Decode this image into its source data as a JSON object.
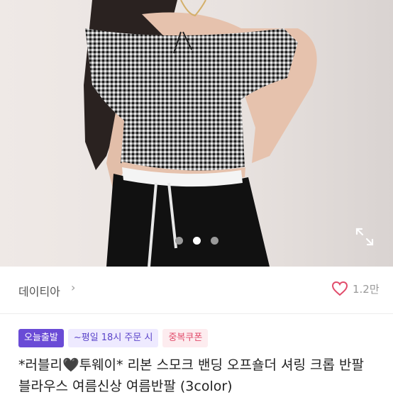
{
  "product": {
    "image_dots": {
      "count": 3,
      "active_index": 1
    },
    "expand_icon": "expand-icon",
    "shop": {
      "name": "데이티아",
      "chevron": "›"
    },
    "like": {
      "count": "1.2만",
      "icon": "heart-outline-icon"
    },
    "badges": {
      "today": "오늘출발",
      "time": "~평일 18시 주문 시",
      "coupon": "중복쿠폰"
    },
    "title": "*러블리🖤투웨이* 리본 스모크 밴딩 오프숄더 셔링 크롭 반팔 블라우스 여름신상 여름반팔 (3color)"
  },
  "colors": {
    "accent": "#6a4bd6",
    "coupon": "#e14c6b"
  }
}
